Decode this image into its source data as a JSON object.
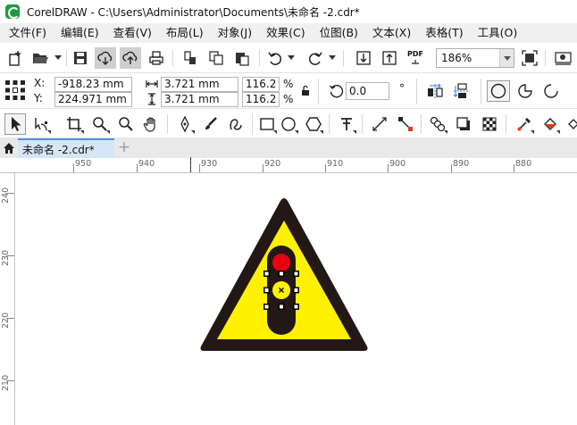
{
  "window": {
    "title": "CorelDRAW - C:\\Users\\Administrator\\Documents\\未命名 -2.cdr*"
  },
  "menu": [
    {
      "label": "文件(F)"
    },
    {
      "label": "编辑(E)"
    },
    {
      "label": "查看(V)"
    },
    {
      "label": "布局(L)"
    },
    {
      "label": "对象(J)"
    },
    {
      "label": "效果(C)"
    },
    {
      "label": "位图(B)"
    },
    {
      "label": "文本(X)"
    },
    {
      "label": "表格(T)"
    },
    {
      "label": "工具(O)"
    }
  ],
  "toolbar": {
    "new_icon": "new-document-icon",
    "open_icon": "open-folder-icon",
    "save_icon": "save-disk-icon",
    "cloud_download_icon": "cloud-download-icon",
    "cloud_upload_icon": "cloud-upload-icon",
    "print_icon": "print-icon",
    "cut_icon": "cut-icon",
    "copy_icon": "copy-icon",
    "paste_icon": "paste-icon",
    "undo_icon": "undo-icon",
    "redo_icon": "redo-icon",
    "import_icon": "import-icon",
    "export_icon": "export-icon",
    "pdf_label": "PDF",
    "zoom_value": "186%",
    "fullscreen_icon": "full-screen-icon",
    "options_icon": "options-icon"
  },
  "properties": {
    "x_label": "X:",
    "y_label": "Y:",
    "x_value": "-918.23 mm",
    "y_value": "224.971 mm",
    "width_value": "3.721 mm",
    "height_value": "3.721 mm",
    "scale_w": "116.2",
    "scale_h": "116.2",
    "percent": "%",
    "rotation_value": "0.0",
    "degree_symbol": "°"
  },
  "tabs": {
    "document_tab": "未命名 -2.cdr*",
    "new_tab_symbol": "+"
  },
  "rulers": {
    "horizontal_labels": [
      "950",
      "940",
      "930",
      "920",
      "910",
      "900",
      "890",
      "880"
    ],
    "vertical_labels": [
      "240",
      "230",
      "220",
      "210"
    ],
    "unit_glyph": "ㄇ"
  },
  "drawing": {
    "triangle_border_color": "#231815",
    "triangle_fill_color": "#fff100",
    "light_body_color": "#231815",
    "red_light_color": "#e60012",
    "yellow_light_color": "#fff100",
    "selection_handle_color": "#000000"
  }
}
